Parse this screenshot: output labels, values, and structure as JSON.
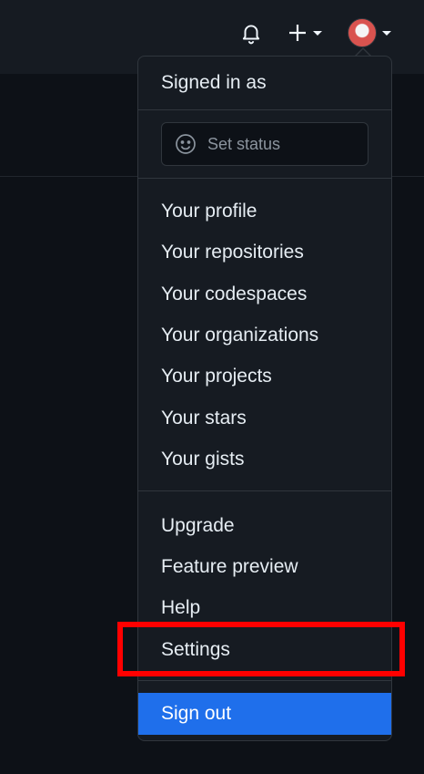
{
  "menu": {
    "signed_in_as": "Signed in as",
    "set_status": "Set status",
    "items_group1": [
      "Your profile",
      "Your repositories",
      "Your codespaces",
      "Your organizations",
      "Your projects",
      "Your stars",
      "Your gists"
    ],
    "items_group2": [
      "Upgrade",
      "Feature preview",
      "Help",
      "Settings"
    ],
    "sign_out": "Sign out"
  },
  "colors": {
    "background": "#0d1117",
    "menu_bg": "#161b22",
    "accent": "#1f6feb",
    "highlight": "#ff0000"
  }
}
